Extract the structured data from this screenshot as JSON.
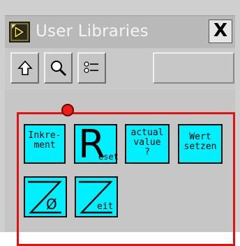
{
  "window": {
    "title": "User Libraries",
    "close_label": "X"
  },
  "toolbar": {
    "buttons": [
      {
        "name": "up",
        "icon": "up-arrow-icon"
      },
      {
        "name": "search",
        "icon": "magnifier-icon"
      },
      {
        "name": "options",
        "icon": "list-options-icon"
      }
    ]
  },
  "palette": {
    "items": [
      {
        "id": "inkrement",
        "label": "Inkre-\nment"
      },
      {
        "id": "reset",
        "big_letter": "R",
        "label_tail": "eset"
      },
      {
        "id": "actual-value",
        "label": "actual\nvalue\n?"
      },
      {
        "id": "wert-setzen",
        "label": "Wert\nsetzen"
      },
      {
        "id": "zero",
        "label": "Ø"
      },
      {
        "id": "zeit",
        "label": "eit"
      }
    ]
  },
  "colors": {
    "tile": "#00f0ff",
    "highlight": "#e31111",
    "dot": "#ee1b1b"
  }
}
